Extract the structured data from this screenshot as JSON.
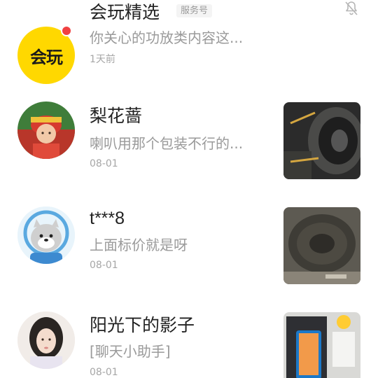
{
  "conversations": [
    {
      "name": "会玩精选",
      "badge": "服务号",
      "logo_text": "会玩",
      "preview": "你关心的功放类内容这...",
      "date": "1天前",
      "unread_dot": true,
      "muted": true,
      "accent": "#ffd800"
    },
    {
      "name": "梨花蔷",
      "preview": "喇叭用那个包装不行的...",
      "date": "08-01",
      "avatar": "child-in-costume-photo",
      "thumbnail": "speaker-photo"
    },
    {
      "name": "t***8",
      "preview": "上面标价就是呀",
      "date": "08-01",
      "avatar": "cartoon-seal-astronaut",
      "thumbnail": "speaker-cone-photo"
    },
    {
      "name": "阳光下的影子",
      "preview": "[聊天小助手]",
      "date": "08-01",
      "avatar": "girl-portrait-photo",
      "thumbnail": "phone-box-photo"
    }
  ],
  "colors": {
    "name": "#222222",
    "preview": "#9a9a9a",
    "unread": "#f04141"
  }
}
